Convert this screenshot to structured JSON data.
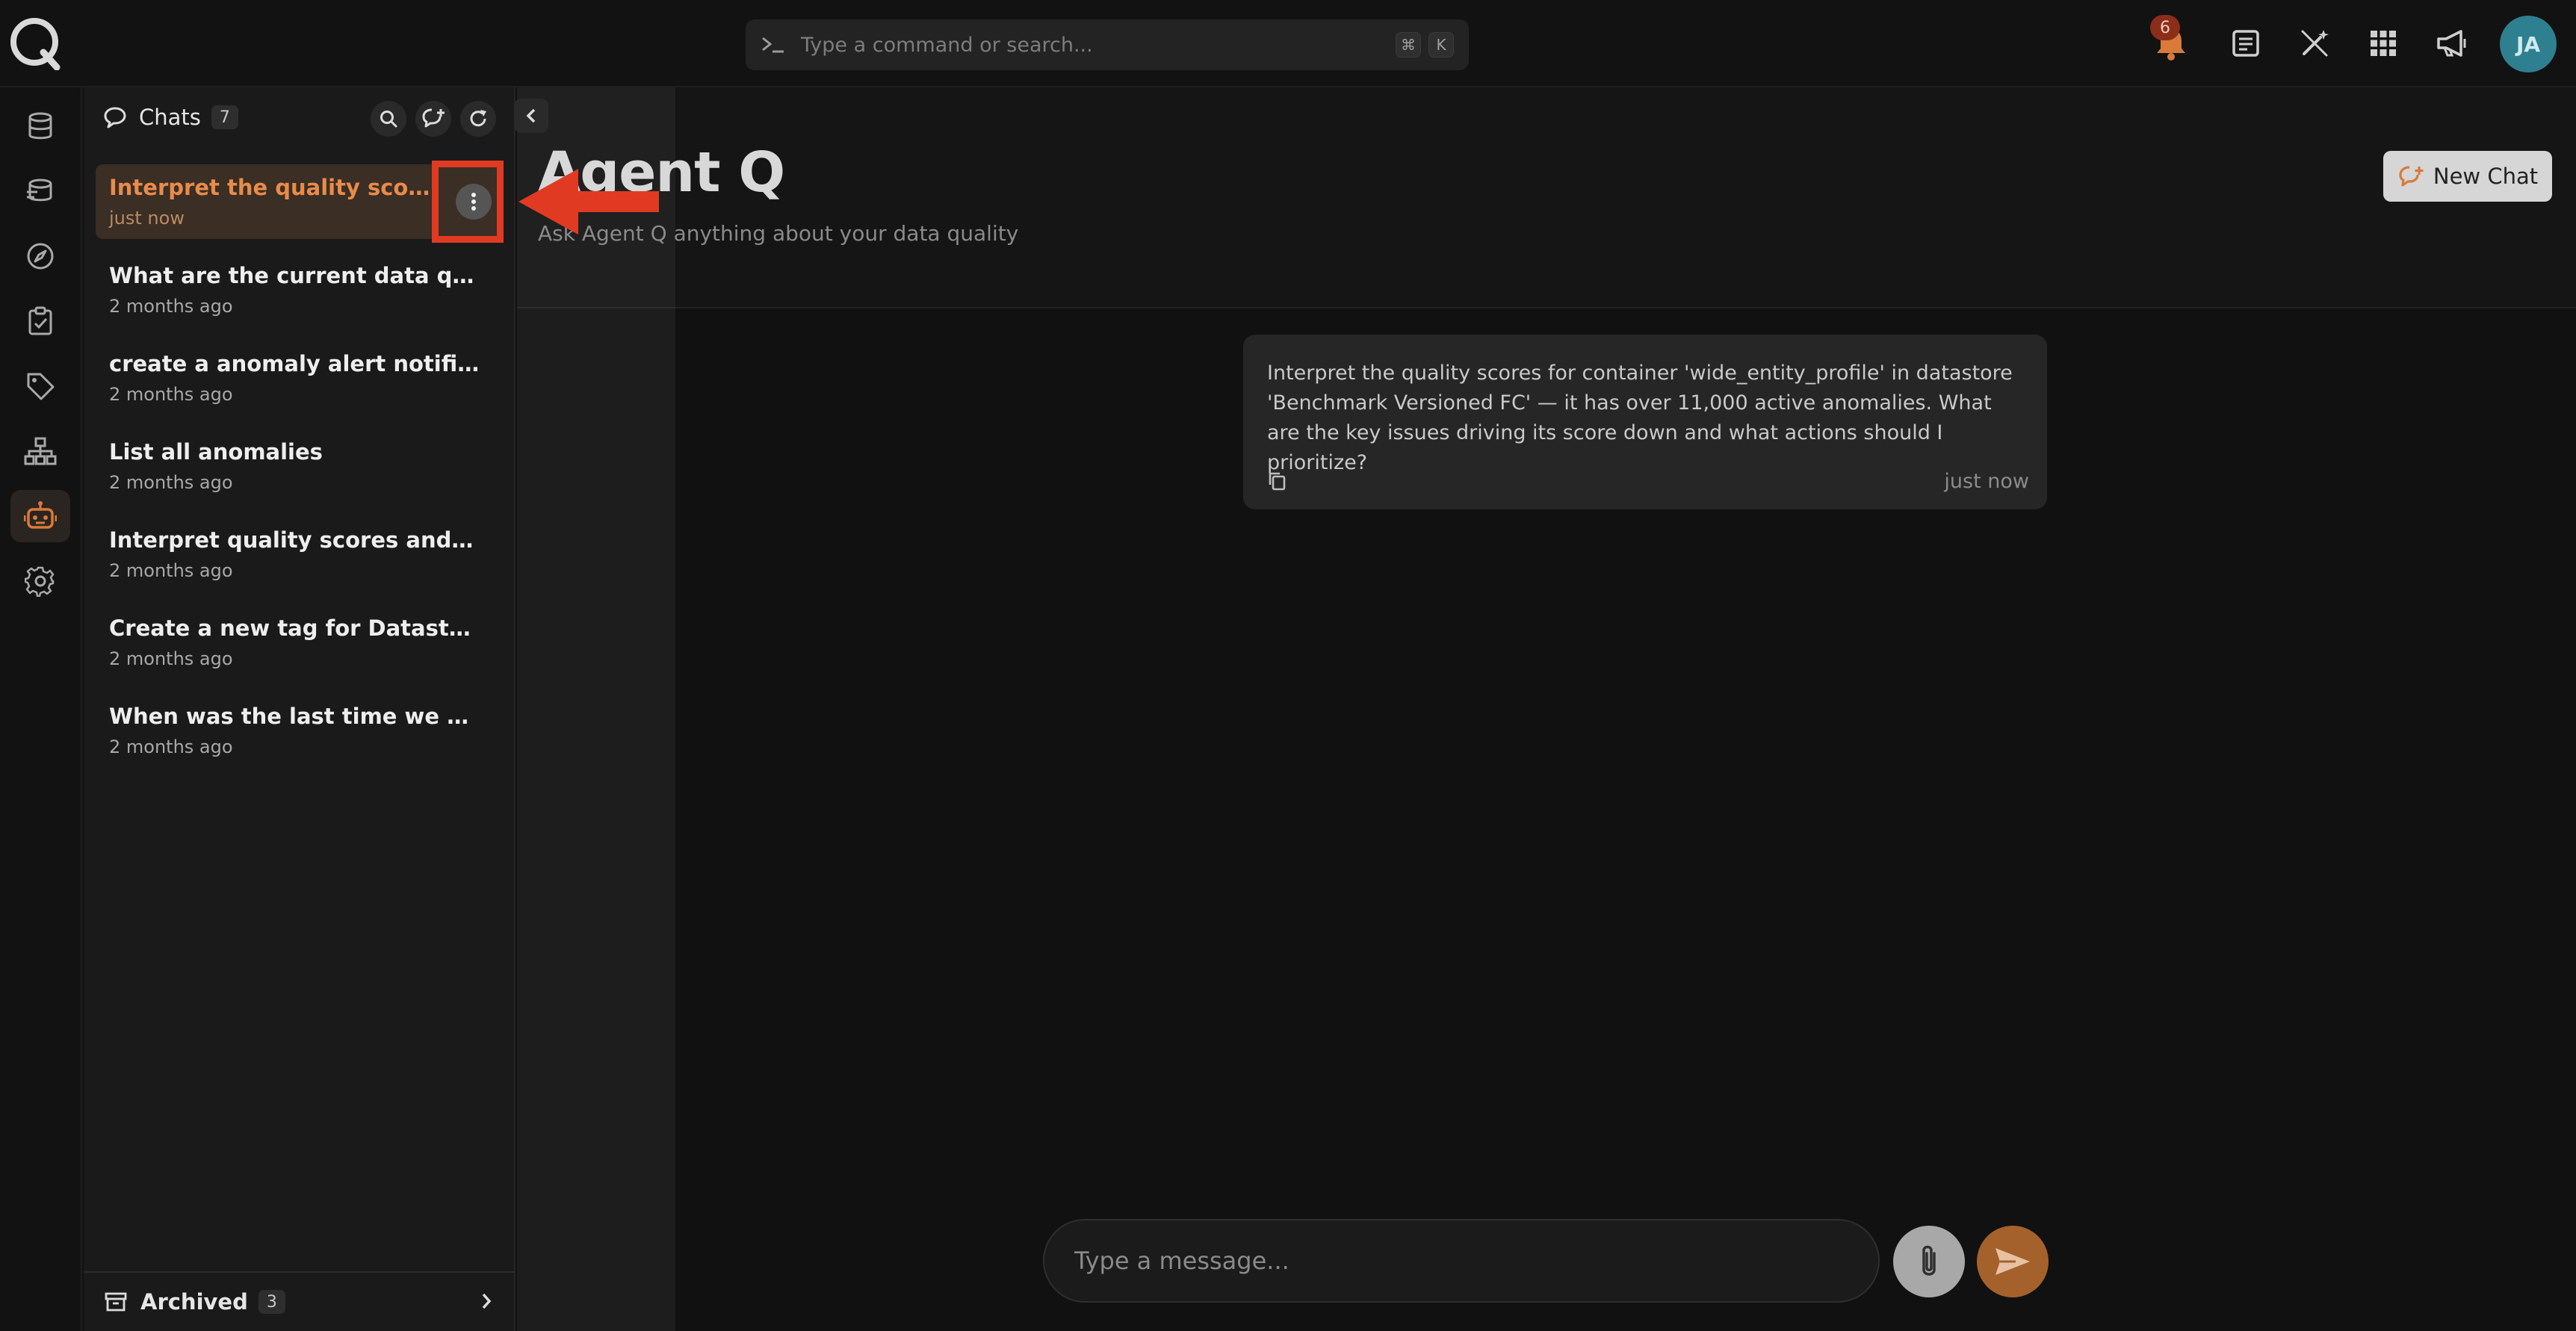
{
  "search": {
    "placeholder": "Type a command or search...",
    "shortcut_mod": "⌘",
    "shortcut_key": "K"
  },
  "notifications": {
    "count": "6"
  },
  "user": {
    "initials": "JA"
  },
  "colors": {
    "accent": "#e98b4a",
    "highlight": "#e03b22",
    "avatar": "#2e7f8f",
    "send": "#a5612b"
  },
  "rail_icons": [
    "database-icon",
    "layers-icon",
    "compass-icon",
    "checklist-icon",
    "tag-icon",
    "hierarchy-icon",
    "robot-icon",
    "gear-icon"
  ],
  "chats": {
    "title": "Chats",
    "count": "7",
    "items": [
      {
        "title": "Interpret the quality scores for container 'wide_entity_profile' in datastore",
        "time": "just now"
      },
      {
        "title": "What are the current data quality scores for my datastores?",
        "time": "2 months ago"
      },
      {
        "title": "create a anomaly alert notification for my datastore",
        "time": "2 months ago"
      },
      {
        "title": "List all anomalies",
        "time": "2 months ago"
      },
      {
        "title": "Interpret quality scores and top anomalies",
        "time": "2 months ago"
      },
      {
        "title": "Create a new tag for Datastore: Analytics",
        "time": "2 months ago"
      },
      {
        "title": "When was the last time we have an anomaly detected?",
        "time": "2 months ago"
      }
    ],
    "archived_label": "Archived",
    "archived_count": "3"
  },
  "main": {
    "title": "Agent Q",
    "subtitle": "Ask Agent Q anything about your data quality",
    "new_chat_label": "New Chat",
    "message": {
      "text": "Interpret the quality scores for container 'wide_entity_profile' in datastore 'Benchmark Versioned FC' — it has over 11,000 active anomalies. What are the key issues driving its score down and what actions should I prioritize?",
      "time": "just now"
    },
    "composer_placeholder": "Type a message..."
  }
}
